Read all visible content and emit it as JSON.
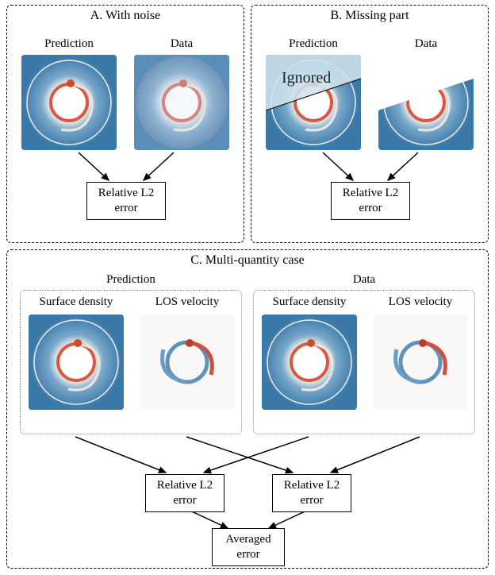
{
  "panelA": {
    "title": "A. With noise",
    "prediction_label": "Prediction",
    "data_label": "Data",
    "error_label": "Relative L2\nerror"
  },
  "panelB": {
    "title": "B. Missing part",
    "prediction_label": "Prediction",
    "data_label": "Data",
    "ignored_label": "Ignored",
    "error_label": "Relative L2\nerror"
  },
  "panelC": {
    "title": "C. Multi-quantity case",
    "prediction_group_label": "Prediction",
    "data_group_label": "Data",
    "surface_density_label": "Surface density",
    "los_velocity_label": "LOS velocity",
    "error_label_left": "Relative L2\nerror",
    "error_label_right": "Relative L2\nerror",
    "averaged_label": "Averaged\nerror"
  }
}
